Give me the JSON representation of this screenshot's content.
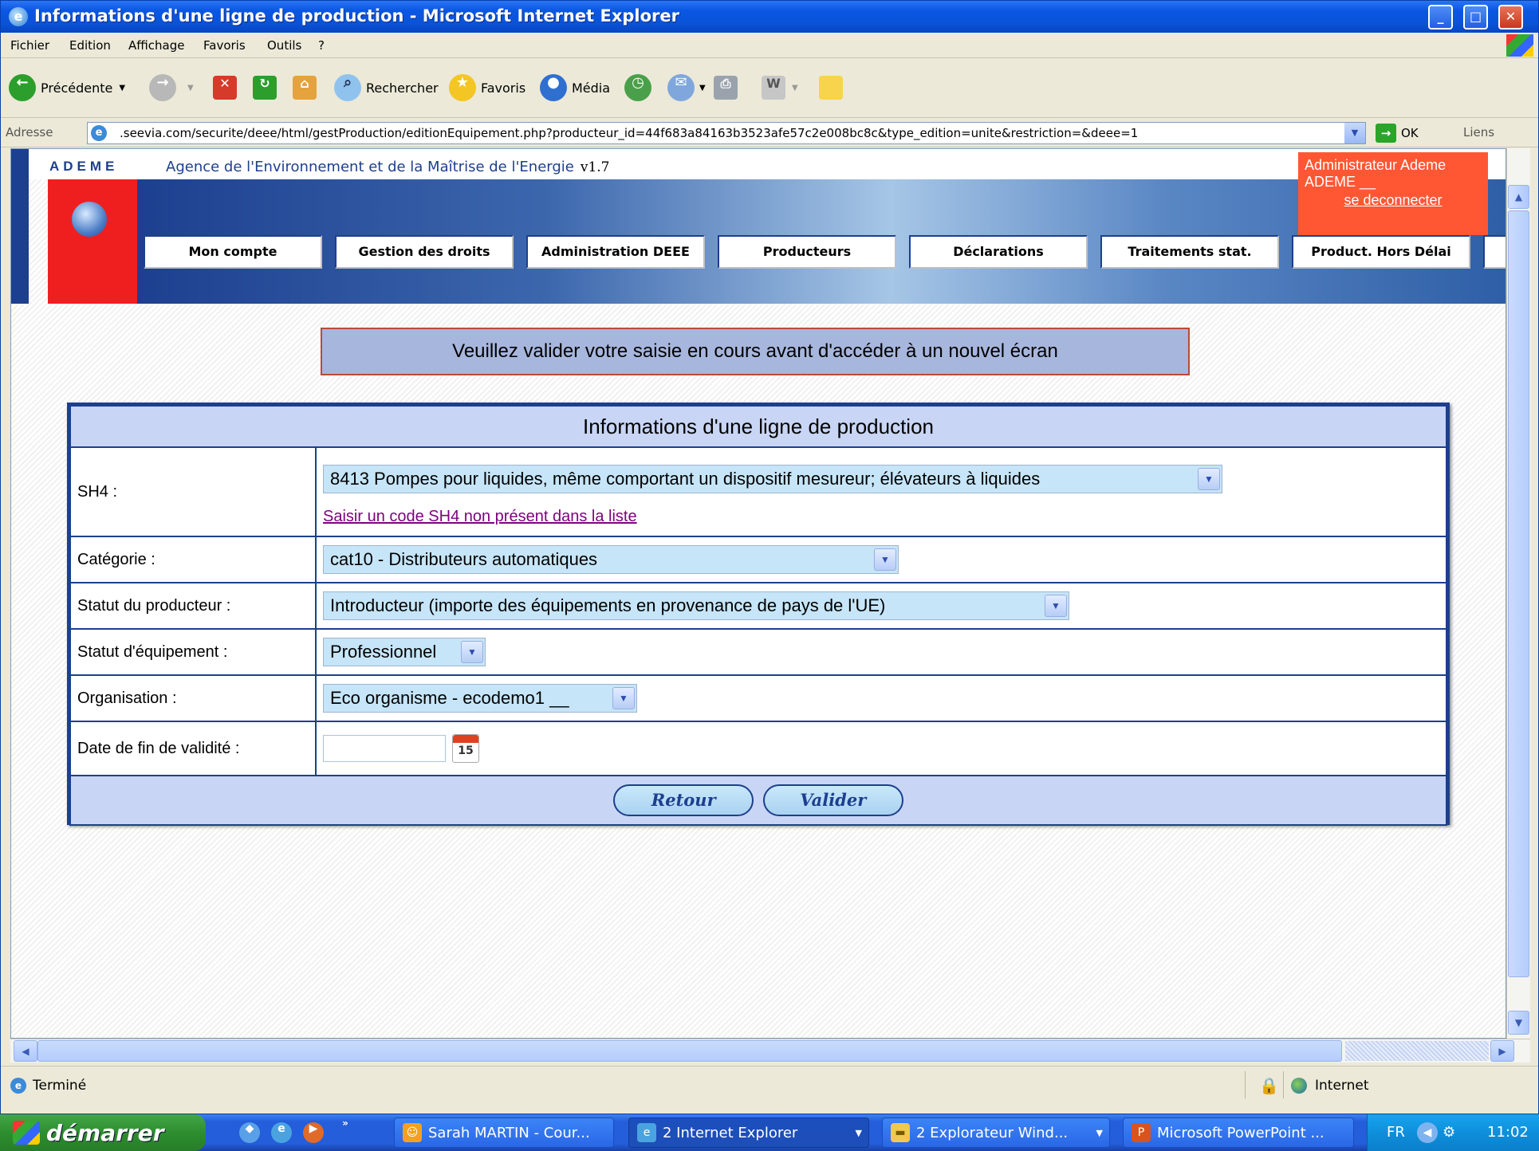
{
  "window": {
    "title": "Informations d'une ligne de production - Microsoft Internet Explorer"
  },
  "menu": [
    "Fichier",
    "Edition",
    "Affichage",
    "Favoris",
    "Outils",
    "?"
  ],
  "toolbar": {
    "back": "Précédente",
    "search": "Rechercher",
    "favorites": "Favoris",
    "media": "Média"
  },
  "address": {
    "label": "Adresse",
    "url": ".seevia.com/securite/deee/html/gestProduction/editionEquipement.php?producteur_id=44f683a84163b3523afe57c2e008bc8c&type_edition=unite&restriction=&deee=1",
    "go": "OK",
    "links": "Liens"
  },
  "site": {
    "logo": "ADEME",
    "agency": "Agence de l'Environnement et de la Maîtrise de l'Energie",
    "version": "v1.7",
    "user_line1": "Administrateur Ademe",
    "user_line2": "ADEME __",
    "logout": "se deconnecter"
  },
  "nav": [
    "Mon compte",
    "Gestion des droits",
    "Administration DEEE",
    "Producteurs",
    "Déclarations",
    "Traitements stat.",
    "Product. Hors Délai"
  ],
  "warning": "Veuillez valider votre saisie en cours avant d'accéder à un nouvel écran",
  "form": {
    "title": "Informations d'une ligne de production",
    "sh4_label": "SH4 :",
    "sh4_value": "8413 Pompes pour liquides, même comportant un dispositif mesureur; élévateurs à liquides",
    "sh4_link": "Saisir un code SH4 non présent dans la liste",
    "categorie_label": "Catégorie :",
    "categorie_value": "cat10 - Distributeurs automatiques",
    "statut_producteur_label": "Statut du producteur :",
    "statut_producteur_value": "Introducteur (importe des équipements en provenance de pays de l'UE)",
    "statut_equipement_label": "Statut d'équipement :",
    "statut_equipement_value": "Professionnel",
    "organisation_label": "Organisation :",
    "organisation_value": "Eco organisme - ecodemo1 __",
    "date_label": "Date de fin de validité :",
    "date_value": "",
    "calendar_day": "15",
    "back_button": "Retour",
    "submit_button": "Valider"
  },
  "status": {
    "text": "Terminé",
    "zone": "Internet"
  },
  "taskbar": {
    "start": "démarrer",
    "tasks": [
      "Sarah MARTIN - Cour...",
      "2 Internet Explorer",
      "2 Explorateur Wind...",
      "Microsoft PowerPoint ..."
    ],
    "lang": "FR",
    "clock": "11:02"
  }
}
